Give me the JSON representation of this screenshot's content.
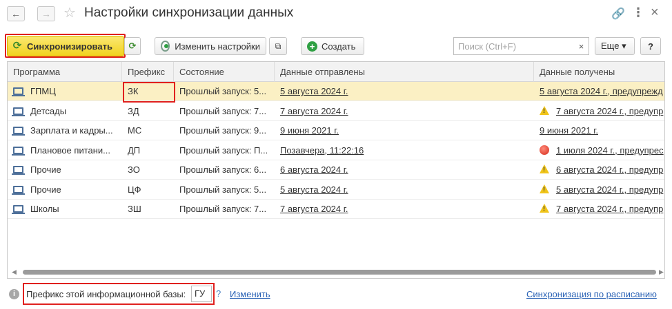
{
  "window": {
    "title": "Настройки синхронизации данных",
    "back_icon": "←",
    "forward_icon": "→",
    "favorite_icon": "☆",
    "link_icon": "🔗",
    "more_icon": "⋮",
    "close_icon": "×"
  },
  "toolbar": {
    "sync_label": "Синхронизировать",
    "change_settings_label": "Изменить настройки",
    "create_label": "Создать",
    "search_placeholder": "Поиск (Ctrl+F)",
    "search_clear": "×",
    "more_label": "Еще ▾",
    "help_label": "?"
  },
  "table": {
    "columns": [
      "Программа",
      "Префикс",
      "Состояние",
      "Данные отправлены",
      "Данные получены"
    ],
    "rows": [
      {
        "program": "ГПМЦ",
        "prefix": "ЗК",
        "state": "Прошлый запуск: 5...",
        "sent": "5 августа 2024 г.",
        "received": "5 августа 2024 г., предупрежд",
        "recv_icon": "none",
        "selected": true
      },
      {
        "program": "Детсады",
        "prefix": "ЗД",
        "state": "Прошлый запуск: 7...",
        "sent": "7 августа 2024 г.",
        "received": "7 августа 2024 г., предупр",
        "recv_icon": "warning"
      },
      {
        "program": "Зарплата и кадры...",
        "prefix": "МС",
        "state": "Прошлый запуск: 9...",
        "sent": "9 июня 2021 г.",
        "received": "9 июня 2021 г.",
        "recv_icon": "none"
      },
      {
        "program": "Плановое питани...",
        "prefix": "ДП",
        "state": "Прошлый запуск: П...",
        "sent": "Позавчера, 11:22:16",
        "received": "1 июля 2024 г., предупрес",
        "recv_icon": "error"
      },
      {
        "program": "Прочие",
        "prefix": "ЗО",
        "state": "Прошлый запуск: 6...",
        "sent": "6 августа 2024 г.",
        "received": "6 августа 2024 г., предупр",
        "recv_icon": "warning"
      },
      {
        "program": "Прочие",
        "prefix": "ЦФ",
        "state": "Прошлый запуск: 5...",
        "sent": "5 августа 2024 г.",
        "received": "5 августа 2024 г., предупр",
        "recv_icon": "warning"
      },
      {
        "program": "Школы",
        "prefix": "ЗШ",
        "state": "Прошлый запуск: 7...",
        "sent": "7 августа 2024 г.",
        "received": "7 августа 2024 г., предупр",
        "recv_icon": "warning"
      }
    ]
  },
  "footer": {
    "prefix_label": "Префикс этой информационной базы:",
    "prefix_value": "ГУ",
    "prefix_help": "?",
    "change_link": "Изменить",
    "schedule_link": "Синхронизация по расписанию"
  },
  "colors": {
    "accent_yellow": "#f1d21e",
    "highlight_red": "#e0201e",
    "selected_row": "#fbf0c4",
    "link_blue": "#2a62b5"
  }
}
